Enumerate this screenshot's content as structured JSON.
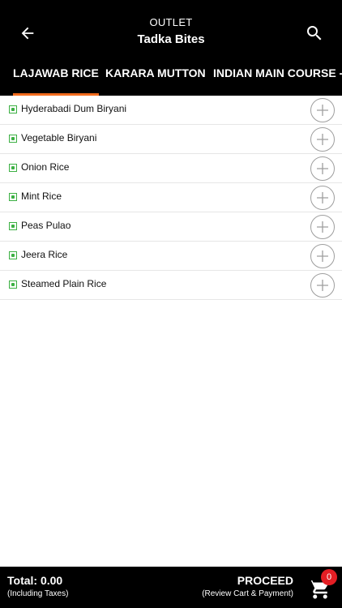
{
  "header": {
    "subtitle": "OUTLET",
    "title": "Tadka Bites",
    "back_icon": "arrow-left-icon",
    "search_icon": "search-icon"
  },
  "tabs": [
    {
      "label": "LAJAWAB RICE",
      "active": true
    },
    {
      "label": "KARARA MUTTON",
      "active": false
    },
    {
      "label": "INDIAN MAIN COURSE - I",
      "active": false
    }
  ],
  "menu_items": [
    {
      "name": "Hyderabadi Dum Biryani"
    },
    {
      "name": "Vegetable Biryani"
    },
    {
      "name": "Onion Rice"
    },
    {
      "name": "Mint Rice"
    },
    {
      "name": "Peas Pulao"
    },
    {
      "name": "Jeera Rice"
    },
    {
      "name": "Steamed Plain Rice"
    }
  ],
  "footer": {
    "total_label": "Total:  0.00",
    "total_note": "(Including Taxes)",
    "proceed_label": "PROCEED",
    "proceed_note": "(Review Cart & Payment)",
    "cart_count": "0",
    "cart_icon": "cart-icon"
  },
  "colors": {
    "header_bg": "#000000",
    "tab_underline": "#f26b1d",
    "veg_green": "#3cb043",
    "badge_red": "#e31e24"
  }
}
